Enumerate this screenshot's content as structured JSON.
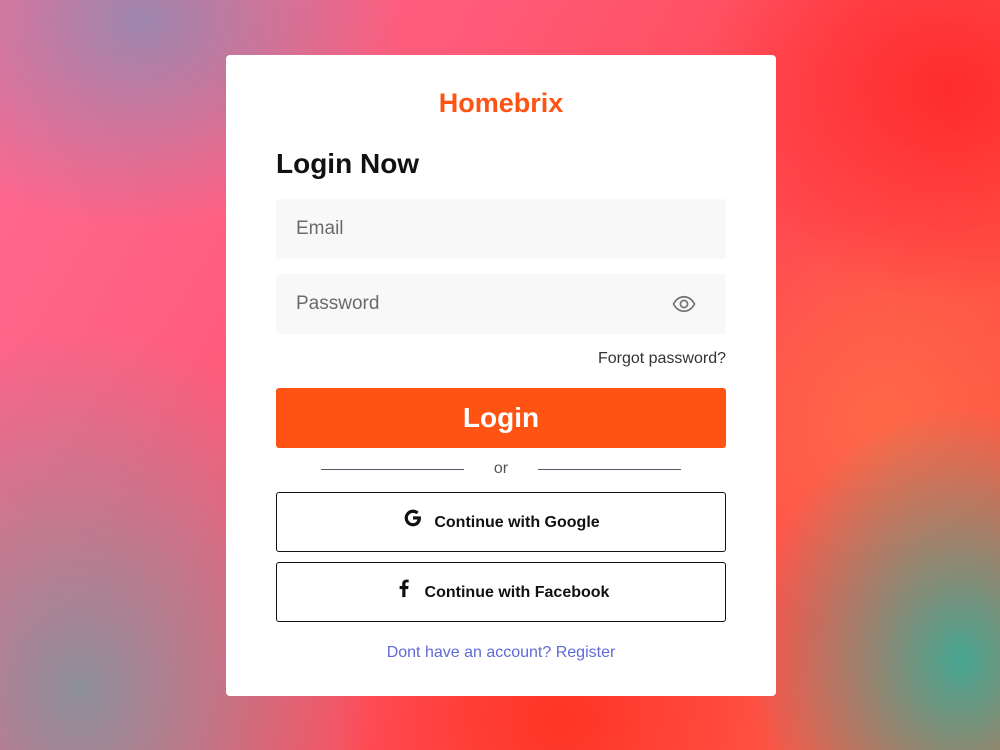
{
  "brand": {
    "name": "Homebrix",
    "color": "#ff5314"
  },
  "form": {
    "heading": "Login Now",
    "email_placeholder": "Email",
    "email_value": "",
    "password_placeholder": "Password",
    "password_value": "",
    "password_toggle_icon": "eye-icon",
    "forgot_label": "Forgot password?",
    "login_label": "Login",
    "divider_label": "or"
  },
  "social": {
    "google_label": "Continue with Google",
    "google_icon": "google-icon",
    "facebook_label": "Continue with Facebook",
    "facebook_icon": "facebook-icon"
  },
  "footer": {
    "register_label": "Dont have an account? Register",
    "link_color": "#5f6bd6"
  }
}
